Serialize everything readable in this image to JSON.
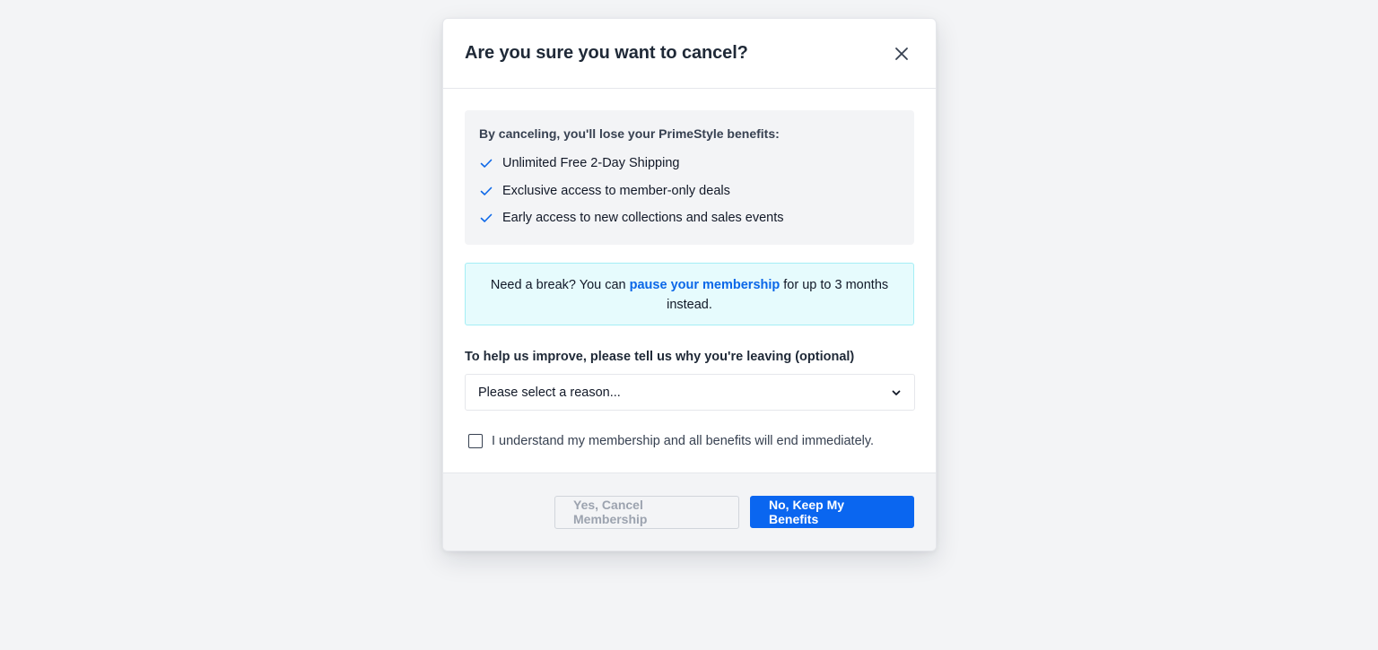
{
  "modal": {
    "title": "Are you sure you want to cancel?",
    "close_icon": "close-icon"
  },
  "benefits": {
    "heading": "By canceling, you'll lose your PrimeStyle benefits:",
    "check_color": "#0b67e8",
    "items": [
      {
        "label": "Unlimited Free 2-Day Shipping",
        "icon": "check-icon"
      },
      {
        "label": "Exclusive access to member-only deals",
        "icon": "check-icon"
      },
      {
        "label": "Early access to new collections and sales events",
        "icon": "check-icon"
      }
    ]
  },
  "pause": {
    "prefix": "Need a break? You can ",
    "link_text": "pause your membership",
    "suffix": " for up to 3 months instead.",
    "link_color": "#0b67e8"
  },
  "reason": {
    "label": "To help us improve, please tell us why you're leaving (optional)",
    "selected": "Please select a reason...",
    "dropdown_icon": "chevron-down-icon"
  },
  "confirm": {
    "label": "I understand my membership and all benefits will end immediately.",
    "checked": false
  },
  "footer": {
    "cancel_label": "Yes, Cancel Membership",
    "keep_label": "No, Keep My Benefits",
    "primary_color": "#0a66f0"
  }
}
